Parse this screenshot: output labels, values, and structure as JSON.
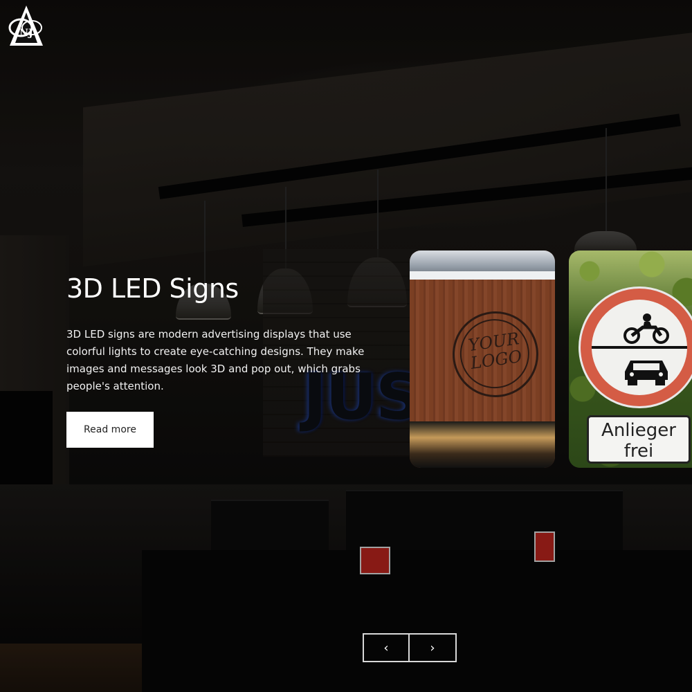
{
  "hero": {
    "title": "3D LED Signs",
    "description": "3D LED signs are modern advertising displays that use colorful lights to create eye-catching designs. They make images and messages look 3D and pop out, which grabs people's attention.",
    "read_more_label": "Read more"
  },
  "cards": {
    "logo_card": {
      "stamp_text_line1": "YOUR",
      "stamp_text_line2": "LOGO"
    },
    "sign_card": {
      "plate_line1": "Anlieger",
      "plate_line2": "frei"
    }
  },
  "background": {
    "sign_text": "JUS"
  },
  "nav": {
    "prev_icon": "‹",
    "next_icon": "›"
  },
  "colors": {
    "accent": "#ffffff",
    "button_bg": "#ffffff",
    "button_text": "#222222"
  }
}
